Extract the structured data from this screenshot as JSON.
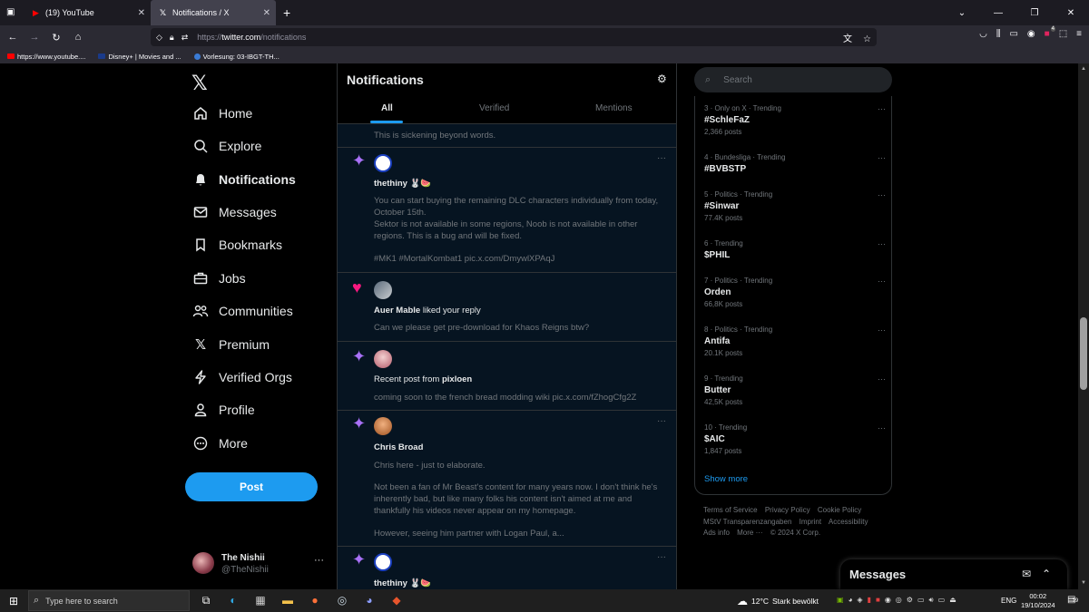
{
  "browser": {
    "tabs": [
      {
        "title": "(19) YouTube",
        "icon": "youtube-icon",
        "active": false
      },
      {
        "title": "Notifications / X",
        "icon": "x-icon",
        "active": true
      }
    ],
    "url_prefix": "https://",
    "url_host": "twitter.com",
    "url_path": "/notifications",
    "bookmarks": [
      {
        "label": "https://www.youtube....",
        "icon": "youtube-icon",
        "color": "#ff0000"
      },
      {
        "label": "Disney+ | Movies and ...",
        "icon": "disney-icon",
        "color": "#1a3a8a"
      },
      {
        "label": "Vorlesung: 03-IBGT-TH...",
        "icon": "globe-icon",
        "color": "#3a7bd5"
      }
    ],
    "extension_badge": "4"
  },
  "sidebar": {
    "items": [
      {
        "label": "Home",
        "icon": "home-icon"
      },
      {
        "label": "Explore",
        "icon": "search-icon"
      },
      {
        "label": "Notifications",
        "icon": "bell-icon"
      },
      {
        "label": "Messages",
        "icon": "envelope-icon"
      },
      {
        "label": "Bookmarks",
        "icon": "bookmark-icon"
      },
      {
        "label": "Jobs",
        "icon": "briefcase-icon"
      },
      {
        "label": "Communities",
        "icon": "people-icon"
      },
      {
        "label": "Premium",
        "icon": "x-icon"
      },
      {
        "label": "Verified Orgs",
        "icon": "lightning-icon"
      },
      {
        "label": "Profile",
        "icon": "person-icon"
      },
      {
        "label": "More",
        "icon": "more-circle-icon"
      }
    ],
    "post_label": "Post",
    "account": {
      "name": "The Nishii",
      "handle": "@TheNishii"
    }
  },
  "notifications": {
    "title": "Notifications",
    "tabs": [
      "All",
      "Verified",
      "Mentions"
    ],
    "selected_tab": "All",
    "items": [
      {
        "partial_text": "This is sickening beyond words."
      },
      {
        "type": "post",
        "icon": "sparkle-icon",
        "author": "thethiny",
        "author_emoji": "🐰🍉",
        "lines": [
          "You can start buying the remaining DLC characters individually from today, October 15th.",
          "Sektor is not available in some regions, Noob is not available in other regions. This is a bug and will be fixed."
        ],
        "hashtags": "#MK1 #MortalKombat1 pic.x.com/DmywlXPAqJ"
      },
      {
        "type": "like",
        "icon": "heart-icon",
        "user": "Auer Mable",
        "action": " liked your reply",
        "body": "Can we please get pre-download for Khaos Reigns btw?"
      },
      {
        "type": "recent",
        "icon": "sparkle-icon",
        "prefix": "Recent post from ",
        "user": "pixloen",
        "body": "coming soon to the french bread modding wiki pic.x.com/fZhogCfg2Z"
      },
      {
        "type": "post",
        "icon": "sparkle-icon",
        "author": "Chris Broad",
        "p1": "Chris here - just to elaborate.",
        "p2": "Not been a fan of Mr Beast's content for many years now. I don't think he's inherently bad, but like many folks his content isn't aimed at me and thankfully his videos never appear on my homepage.",
        "p3": "However, seeing him partner with Logan Paul, a..."
      },
      {
        "type": "post",
        "icon": "sparkle-icon",
        "author": "thethiny",
        "author_emoji": "🐰🍉"
      }
    ]
  },
  "search": {
    "placeholder": "Search"
  },
  "trends": [
    {
      "meta": "3 · Only on X · Trending",
      "name": "#SchleFaZ",
      "posts": "2,366 posts"
    },
    {
      "meta": "4 · Bundesliga · Trending",
      "name": "#BVBSTP",
      "posts": ""
    },
    {
      "meta": "5 · Politics · Trending",
      "name": "#Sinwar",
      "posts": "77.4K posts"
    },
    {
      "meta": "6 · Trending",
      "name": "$PHIL",
      "posts": ""
    },
    {
      "meta": "7 · Politics · Trending",
      "name": "Orden",
      "posts": "66,8K posts"
    },
    {
      "meta": "8 · Politics · Trending",
      "name": "Antifa",
      "posts": "20.1K posts"
    },
    {
      "meta": "9 · Trending",
      "name": "Butter",
      "posts": "42,5K posts"
    },
    {
      "meta": "10 · Trending",
      "name": "$AIC",
      "posts": "1,847 posts"
    }
  ],
  "show_more": "Show more",
  "footer": {
    "links": [
      "Terms of Service",
      "Privacy Policy",
      "Cookie Policy",
      "MStV Transparenzangaben",
      "Imprint",
      "Accessibility",
      "Ads info",
      "More ···",
      "© 2024 X Corp."
    ]
  },
  "messages_drawer": {
    "title": "Messages"
  },
  "taskbar": {
    "search_placeholder": "Type here to search",
    "weather_temp": "12°C",
    "weather_text": "Stark bewölkt",
    "language": "ENG",
    "time": "00:02",
    "date": "19/10/2024",
    "notif_count": "19"
  }
}
